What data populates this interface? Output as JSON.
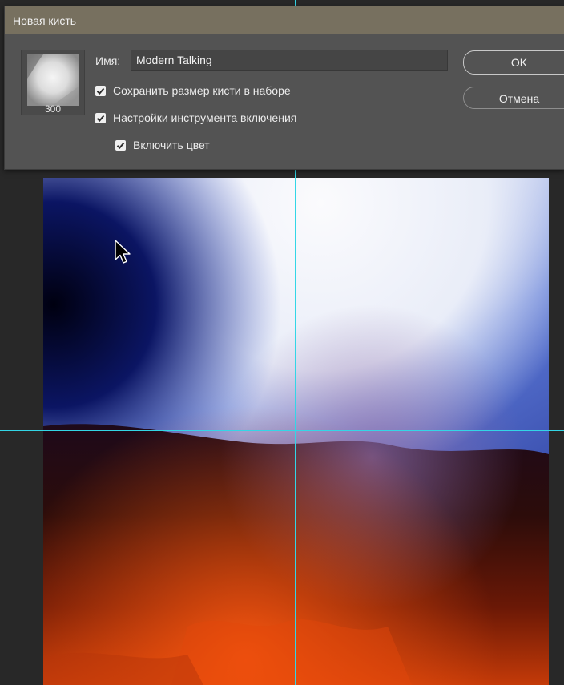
{
  "dialog": {
    "title": "Новая кисть",
    "preview_size": "300",
    "name_label_accel": "И",
    "name_label_rest": "мя:",
    "name_value": "Modern Talking",
    "checkboxes": [
      {
        "label": "Сохранить размер кисти в наборе",
        "checked": true
      },
      {
        "label": "Настройки инструмента включения",
        "checked": true
      },
      {
        "label": "Включить цвет",
        "checked": true
      }
    ],
    "ok_label": "OK",
    "cancel_label": "Отмена"
  },
  "colors": {
    "guide": "#33d6e6",
    "titlebar": "#77705f",
    "dialog_bg": "#535353",
    "workspace_bg": "#282828"
  },
  "icons": {
    "cursor": "arrow-cursor-icon",
    "checkmark": "checkmark-icon"
  }
}
